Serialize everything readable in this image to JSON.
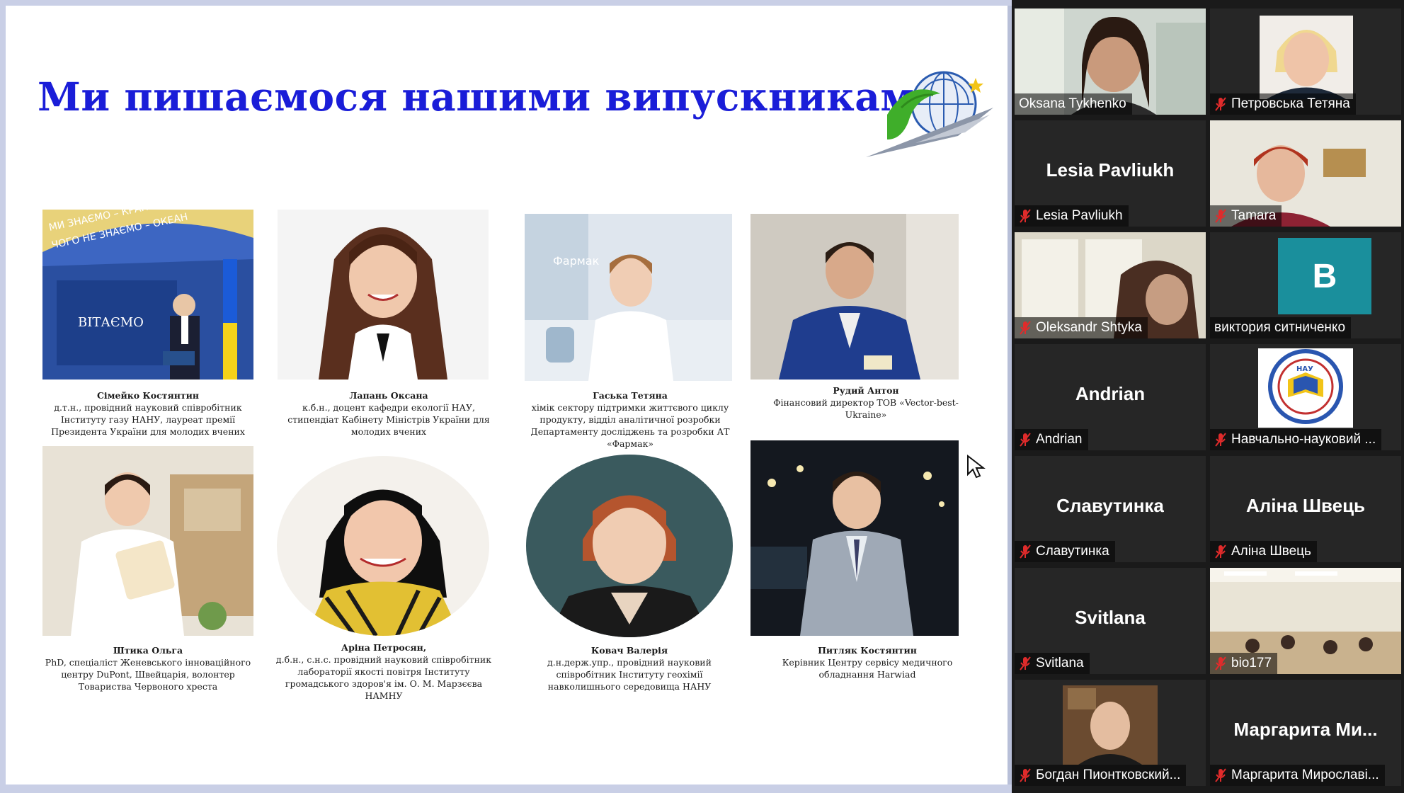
{
  "slide": {
    "title": "Ми пишаємося нашими випускниками",
    "graduates": [
      {
        "name": "Сімейко Костянтин",
        "desc": "д.т.н., провідний науковий співробітник Інституту газу НАНУ, лауреат премії Президента України для молодих вчених"
      },
      {
        "name": "Лапань Оксана",
        "desc": "к.б.н., доцент кафедри екології НАУ, стипендіат Кабінету Міністрів України для молодих вчених"
      },
      {
        "name": "Гаська Тетяна",
        "desc": "хімік сектору підтримки життєвого циклу продукту, відділ аналітичної розробки Департаменту досліджень та розробки АТ «Фармак»"
      },
      {
        "name": "Рудий Антон",
        "desc": "Фінансовий директор ТОВ «Vector-best-Ukraine»"
      },
      {
        "name": "Штика Ольга",
        "desc": "PhD, спеціаліст Женевського інноваційного центру DuPont, Швейцарія, волонтер Товариства Червоного хреста"
      },
      {
        "name": "Аріна Петросян,",
        "desc": "д.б.н., с.н.с. провідний науковий співробітник лабораторії якості повітря Інституту громадського здоров'я ім. О. М. Марзєєва НАМНУ"
      },
      {
        "name": "Ковач Валерія",
        "desc": "д.н.держ.упр., провідний науковий співробітник Інституту геохімії навколишнього середовища НАНУ"
      },
      {
        "name": "Питляк Костянтин",
        "desc": "Керівник Центру сервісу медичного обладнання Harwiad"
      }
    ],
    "photo_texts": {
      "banner_line1": "МИ ЗНАЄМО – КРАПЛЯ",
      "banner_line2": "ЧОГО НЕ ЗНАЄМО – ОКЕАН",
      "vitaemo": "ВІТАЄМО",
      "farmak": "Фармак"
    }
  },
  "participants": [
    {
      "name": "Oksana Tykhenko",
      "video": true,
      "muted": false,
      "active": true
    },
    {
      "name": "Петровська Тетяна",
      "video": true,
      "muted": true
    },
    {
      "name": "Lesia Pavliukh",
      "big_name": "Lesia Pavliukh",
      "video": false,
      "muted": true
    },
    {
      "name": "Tamara",
      "video": true,
      "muted": true
    },
    {
      "name": "Oleksandr Shtyka",
      "video": true,
      "muted": true
    },
    {
      "name": "виктория ситниченко",
      "avatar_letter": "B",
      "video": false,
      "muted": false
    },
    {
      "name": "Andrian",
      "big_name": "Andrian",
      "video": false,
      "muted": true
    },
    {
      "name": "Навчально-науковий ...",
      "logo_text": "НАУ",
      "video": true,
      "muted": true
    },
    {
      "name": "Славутинка",
      "big_name": "Славутинка",
      "video": false,
      "muted": true
    },
    {
      "name": "Аліна Швець",
      "big_name": "Аліна Швець",
      "video": false,
      "muted": true
    },
    {
      "name": "Svitlana",
      "big_name": "Svitlana",
      "video": false,
      "muted": true
    },
    {
      "name": "bio177",
      "video": true,
      "muted": true
    },
    {
      "name": "Богдан Пионтковский...",
      "video": true,
      "muted": true
    },
    {
      "name": "Маргарита Мирославі...",
      "big_name": "Маргарита Ми...",
      "video": false,
      "muted": true
    }
  ],
  "colors": {
    "title": "#1a1dd8",
    "panel_bg": "#1a1a1a",
    "tile_bg": "#262626",
    "active_border": "#b9d32b",
    "muted_icon": "#e02b2b",
    "avatar_bg": "#1a8f9c"
  }
}
